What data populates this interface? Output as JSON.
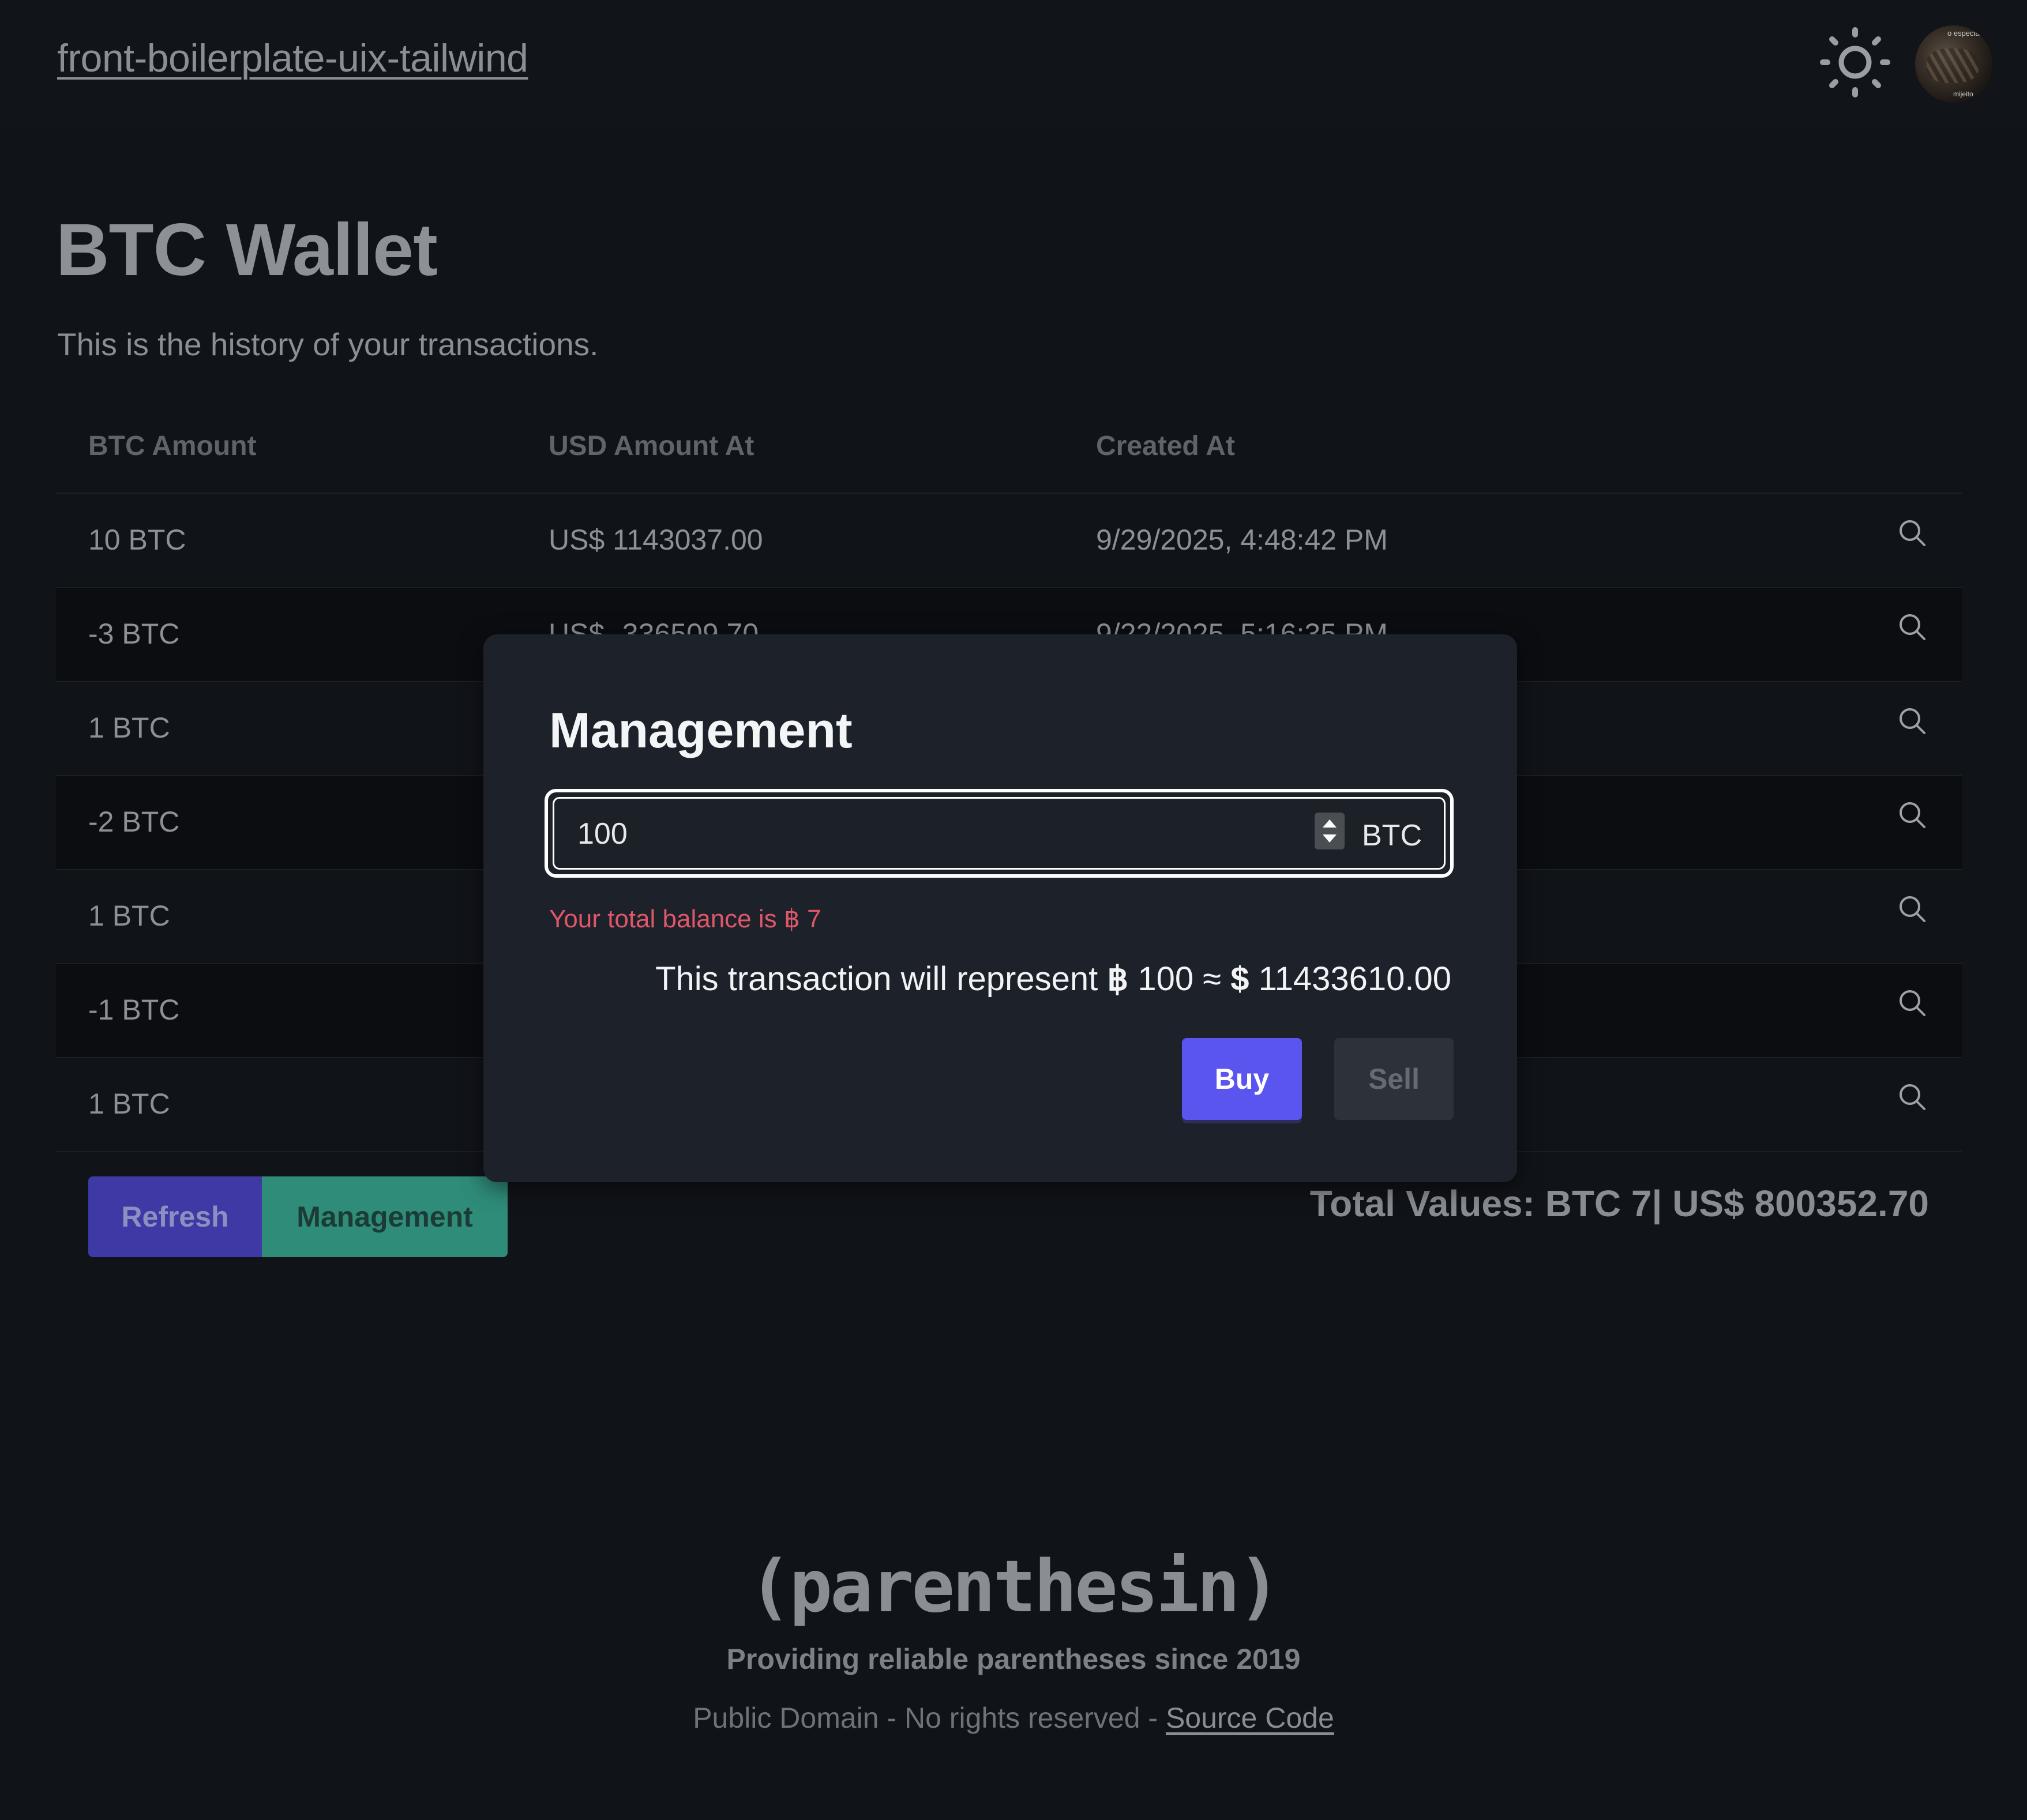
{
  "header": {
    "brand": "front-boilerplate-uix-tailwind",
    "theme_icon": "sun-icon",
    "avatar_text_top": "o especial...",
    "avatar_text_bottom": "mijeito"
  },
  "page": {
    "title": "BTC Wallet",
    "subtitle": "This is the history of your transactions."
  },
  "table": {
    "columns": [
      "BTC Amount",
      "USD Amount At",
      "Created At"
    ],
    "rows": [
      {
        "btc": "10 BTC",
        "usd": "US$ 1143037.00",
        "created": "9/29/2025, 4:48:42 PM"
      },
      {
        "btc": "-3 BTC",
        "usd": "US$ -336509.70",
        "created": "9/22/2025, 5:16:35 PM"
      },
      {
        "btc": "1 BTC",
        "usd": "",
        "created": ""
      },
      {
        "btc": "-2 BTC",
        "usd": "",
        "created": ""
      },
      {
        "btc": "1 BTC",
        "usd": "",
        "created": ""
      },
      {
        "btc": "-1 BTC",
        "usd": "",
        "created": ""
      },
      {
        "btc": "1 BTC",
        "usd": "",
        "created": ""
      }
    ]
  },
  "actions": {
    "refresh": "Refresh",
    "management": "Management"
  },
  "totals": "Total Values: BTC 7| US$ 800352.70",
  "modal": {
    "title": "Management",
    "amount_value": "100",
    "unit": "BTC",
    "error": "Your total balance is ฿ 7",
    "summary_prefix": "This transaction will represent ",
    "summary_btc": "฿",
    "summary_mid": " 100 ≈ ",
    "summary_usd": "$",
    "summary_value": " 11433610.00",
    "buy": "Buy",
    "sell": "Sell"
  },
  "footer": {
    "logo": "(parenthesin)",
    "tagline": "Providing reliable parentheses since 2019",
    "license": "Public Domain - No rights reserved - ",
    "source_link": "Source Code"
  },
  "colors": {
    "background": "#101318",
    "modal": "#1d2129",
    "primary": "#5b55f0",
    "refresh": "#3f39a6",
    "management": "#2f8c79",
    "error": "#e0576a"
  }
}
